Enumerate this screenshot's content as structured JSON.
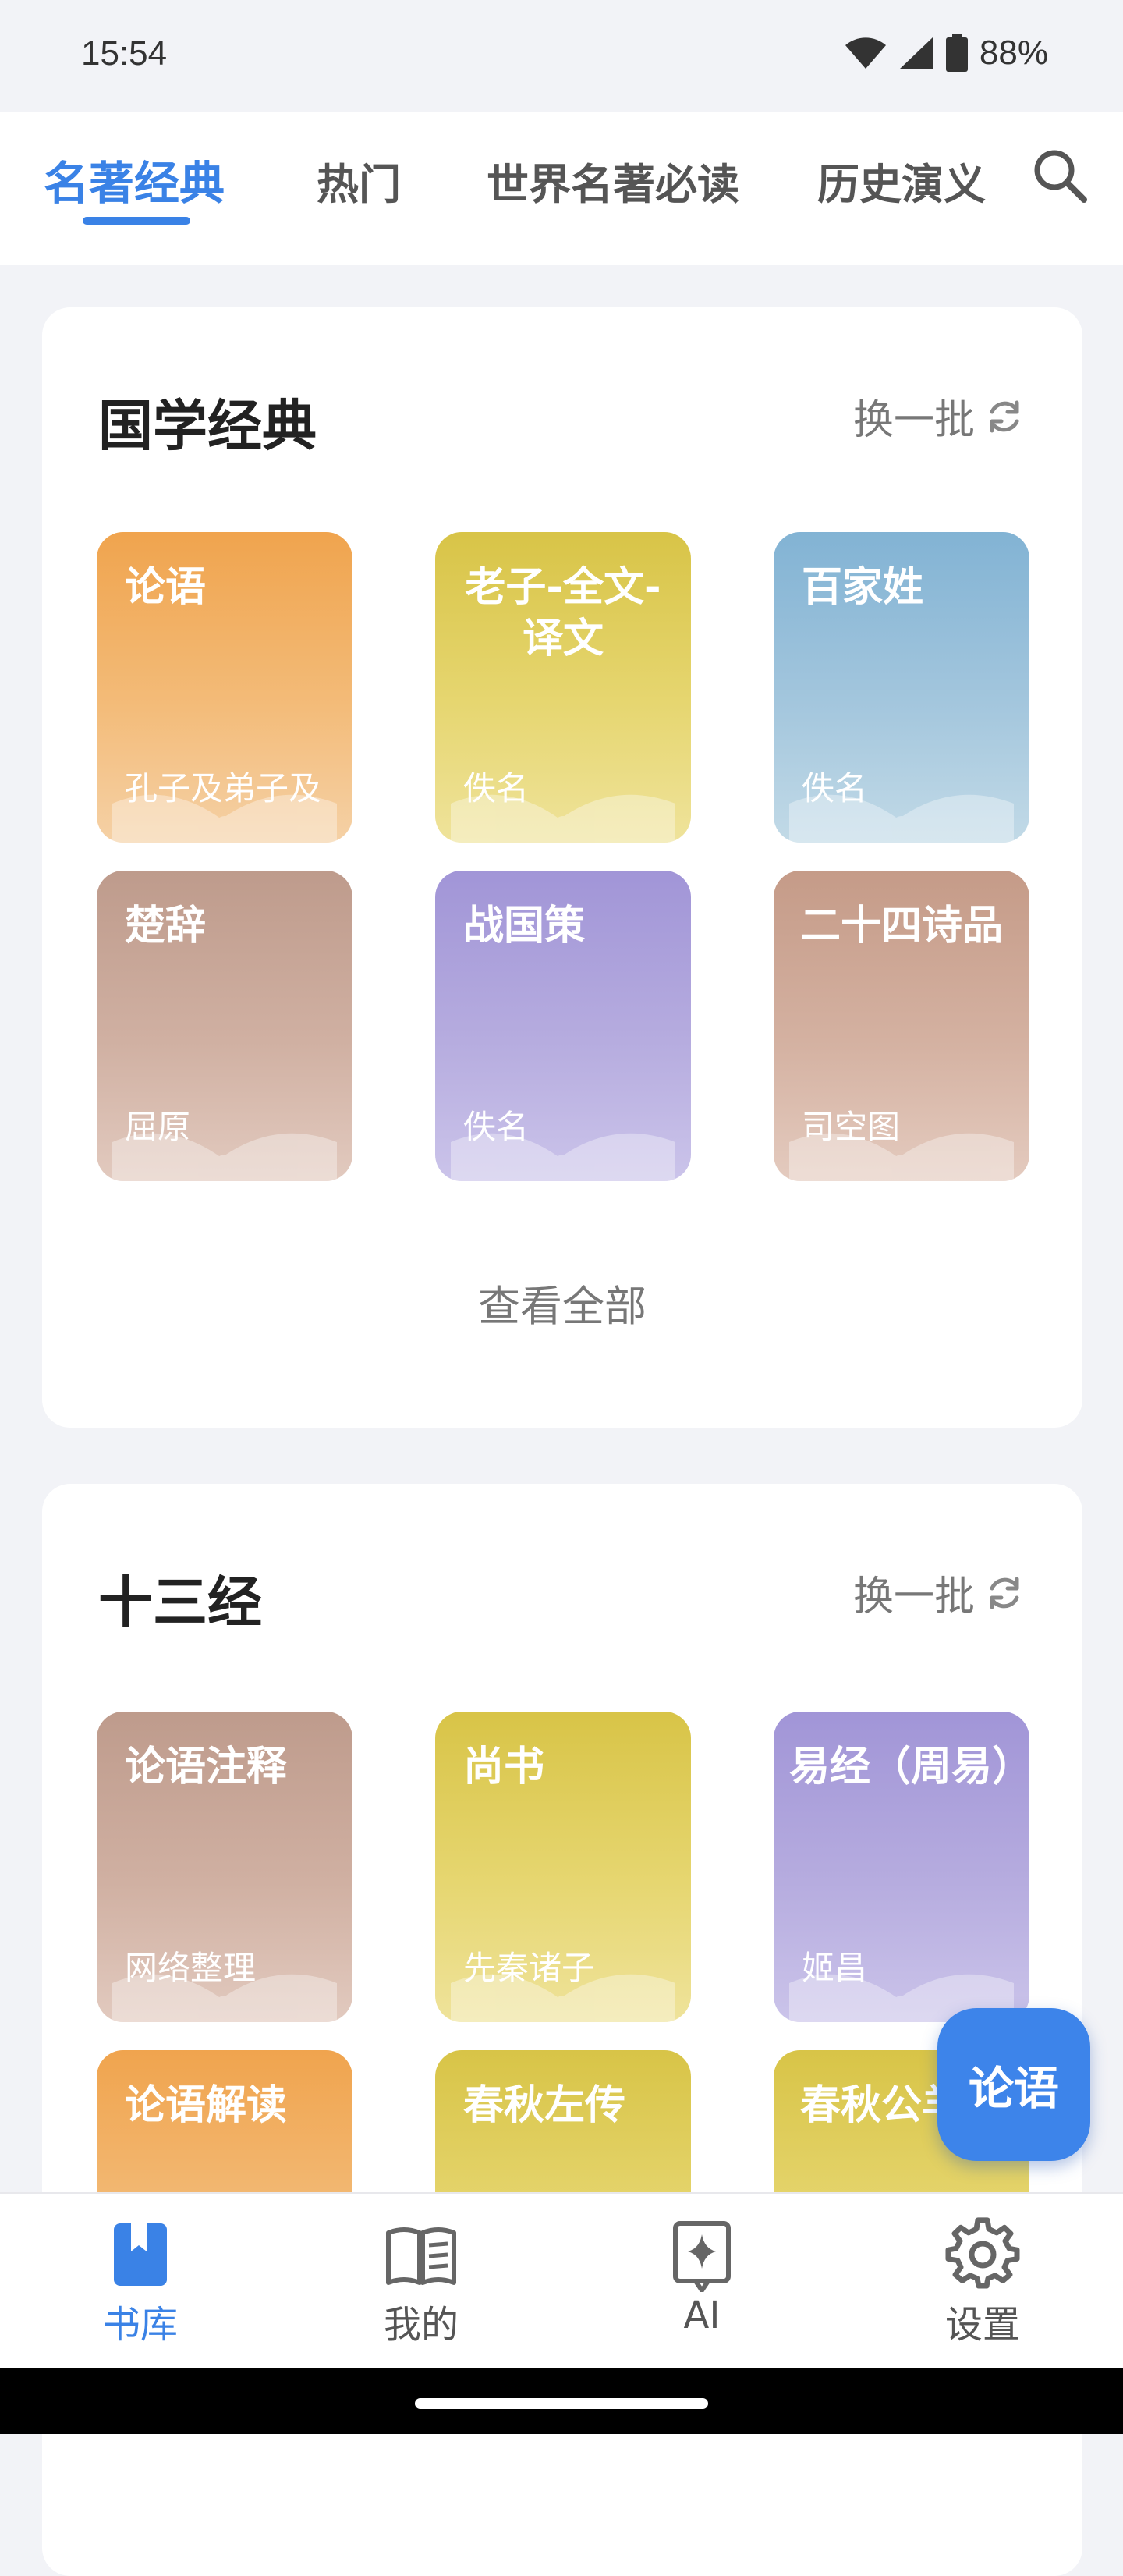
{
  "status_bar": {
    "time": "15:54",
    "battery": "88%"
  },
  "top_tabs": [
    {
      "label": "名著经典",
      "active": true
    },
    {
      "label": "热门"
    },
    {
      "label": "世界名著必读"
    },
    {
      "label": "历史演义"
    }
  ],
  "section1": {
    "title": "国学经典",
    "refresh_label": "换一批",
    "view_all": "查看全部",
    "books": [
      {
        "title": "论语",
        "author": "孔子及弟子及"
      },
      {
        "title": "老子-全文-译文",
        "author": "佚名"
      },
      {
        "title": "百家姓",
        "author": "佚名"
      },
      {
        "title": "楚辞",
        "author": "屈原"
      },
      {
        "title": "战国策",
        "author": "佚名"
      },
      {
        "title": "二十四诗品",
        "author": "司空图"
      }
    ]
  },
  "section2": {
    "title": "十三经",
    "refresh_label": "换一批",
    "books": [
      {
        "title": "论语注释",
        "author": "网络整理"
      },
      {
        "title": "尚书",
        "author": "先秦诸子"
      },
      {
        "title": "易经（周易）",
        "author": "姬昌"
      },
      {
        "title": "论语解读",
        "author": ""
      },
      {
        "title": "春秋左传",
        "author": ""
      },
      {
        "title": "春秋公羊传",
        "author": ""
      }
    ]
  },
  "fab_label": "论语",
  "bottom_nav": [
    {
      "label": "书库",
      "icon": "bookmark-icon",
      "active": true
    },
    {
      "label": "我的",
      "icon": "open-book-icon"
    },
    {
      "label": "AI",
      "icon": "ai-sparkle-icon"
    },
    {
      "label": "设置",
      "icon": "gear-icon"
    }
  ],
  "colors": {
    "accent": "#3a82e6",
    "background": "#f2f3f7"
  }
}
